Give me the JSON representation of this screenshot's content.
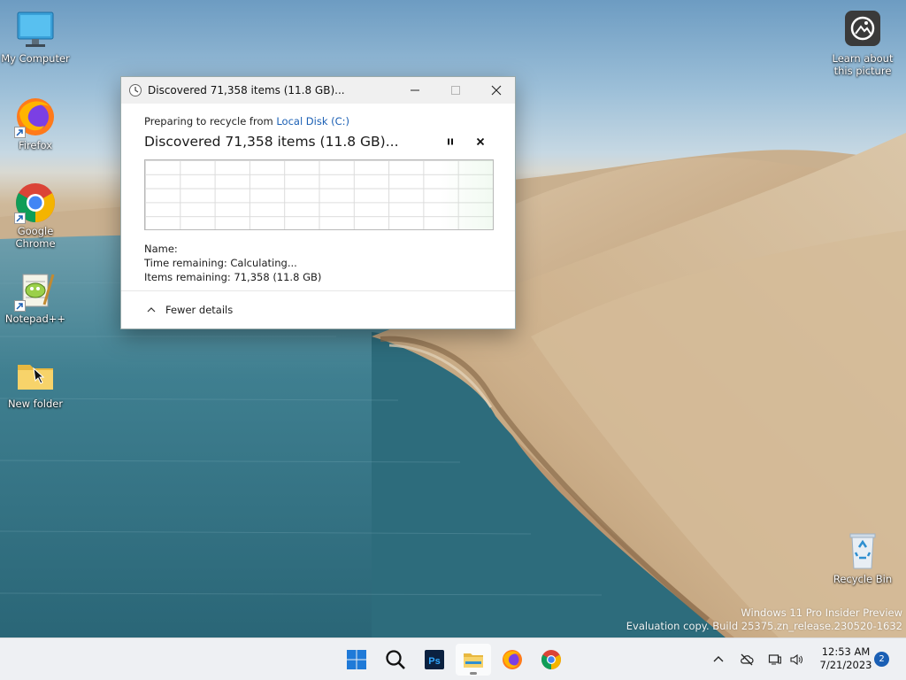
{
  "desktop_icons": [
    {
      "label": "My Computer",
      "icon": "monitor-icon"
    },
    {
      "label": "Firefox",
      "icon": "firefox-icon"
    },
    {
      "label": "Google Chrome",
      "icon": "chrome-icon"
    },
    {
      "label": "Notepad++",
      "icon": "notepadpp-icon"
    },
    {
      "label": "New folder",
      "icon": "folder-icon"
    },
    {
      "label": "Learn about this picture",
      "icon": "spotlight-icon"
    },
    {
      "label": "Recycle Bin",
      "icon": "recycle-bin-icon"
    }
  ],
  "dialog": {
    "title": "Discovered 71,358 items (11.8 GB)...",
    "preparing_prefix": "Preparing to recycle from ",
    "source_link": "Local Disk (C:)",
    "headline": "Discovered 71,358 items (11.8 GB)...",
    "name_label": "Name:",
    "time_remaining": "Time remaining:  Calculating...",
    "items_remaining": "Items remaining:  71,358 (11.8 GB)",
    "fewer_details": "Fewer details"
  },
  "watermark": {
    "line1": "Windows 11 Pro Insider Preview",
    "line2": "Evaluation copy. Build 25375.zn_release.230520-1632"
  },
  "taskbar": {
    "apps": [
      "start-icon",
      "search-icon",
      "photoshop-icon",
      "file-explorer-icon",
      "firefox-icon",
      "chrome-icon"
    ],
    "time": "12:53 AM",
    "date": "7/21/2023",
    "notifications": "2"
  },
  "colors": {
    "accent": "#1a5fb4",
    "taskbar": "#eef0f3"
  }
}
